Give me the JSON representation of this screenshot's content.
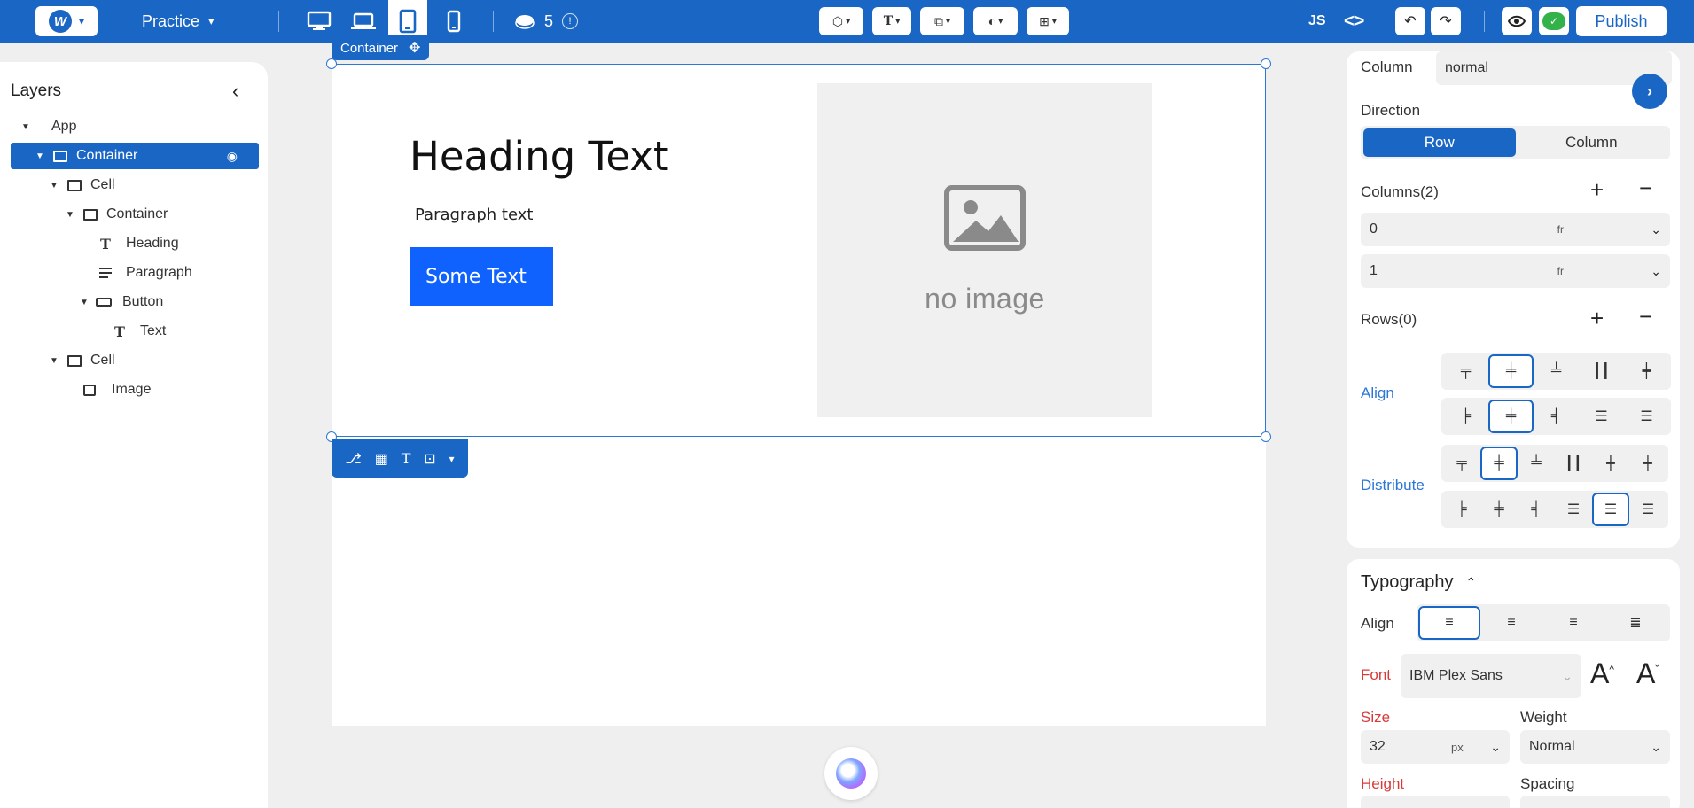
{
  "topbar": {
    "logo_letter": "W",
    "project_name": "Practice",
    "layers_count": "5",
    "js_label": "JS",
    "publish_label": "Publish",
    "accent_color": "#1a66c4"
  },
  "layers": {
    "title": "Layers",
    "tree": [
      {
        "label": "App"
      },
      {
        "label": "Container"
      },
      {
        "label": "Cell"
      },
      {
        "label": "Container"
      },
      {
        "label": "Heading"
      },
      {
        "label": "Paragraph"
      },
      {
        "label": "Button"
      },
      {
        "label": "Text"
      },
      {
        "label": "Cell"
      },
      {
        "label": "Image"
      }
    ]
  },
  "canvas": {
    "selection_label": "Container",
    "heading": "Heading Text",
    "paragraph": "Paragraph text",
    "button_text": "Some Text",
    "image_placeholder": "no image"
  },
  "layout_panel": {
    "column_label": "Column",
    "column_value": "normal",
    "direction_label": "Direction",
    "direction_options": [
      "Row",
      "Column"
    ],
    "direction_selected": "Row",
    "columns_label": "Columns(2)",
    "columns": [
      {
        "value": "0",
        "unit": "fr"
      },
      {
        "value": "1",
        "unit": "fr"
      }
    ],
    "rows_label": "Rows(0)",
    "align_label": "Align",
    "distribute_label": "Distribute"
  },
  "typography": {
    "title": "Typography",
    "align_label": "Align",
    "font_label": "Font",
    "font_value": "IBM Plex Sans",
    "size_label": "Size",
    "size_value": "32",
    "size_unit": "px",
    "weight_label": "Weight",
    "weight_value": "Normal",
    "height_label": "Height",
    "spacing_label": "Spacing"
  }
}
